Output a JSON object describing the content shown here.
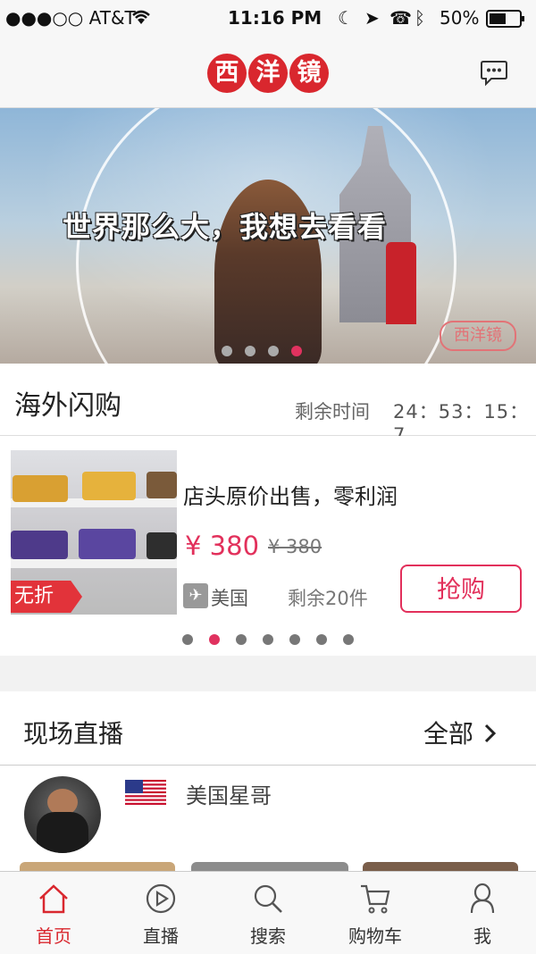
{
  "status_bar": {
    "carrier": "●●●○○ AT&T",
    "time": "11:16 PM",
    "battery": "50%"
  },
  "header": {
    "logo_chars": [
      "西",
      "洋",
      "镜"
    ],
    "message_icon": "chat-bubble-icon"
  },
  "banner": {
    "slogan": "世界那么大，我想去看看",
    "watermark": "西洋镜",
    "dots": 4,
    "active_dot": 3
  },
  "flash_sale": {
    "title": "海外闪购",
    "timer_label": "剩余时间",
    "timer": "24：53：15：7"
  },
  "product": {
    "name": "店头原价出售，零利润",
    "price": "¥ 380",
    "original_price": "¥ 380",
    "tag": "无折",
    "origin": "美国",
    "stock": "剩余20件",
    "buy_label": "抢购",
    "dots": 7,
    "active_dot": 1
  },
  "live": {
    "title": "现场直播",
    "all_label": "全部",
    "anchor_name": "美国星哥",
    "flag_icon": "us-flag-icon"
  },
  "tabbar": {
    "items": [
      {
        "label": "首页",
        "icon": "home-icon",
        "active": true
      },
      {
        "label": "直播",
        "icon": "play-icon",
        "active": false
      },
      {
        "label": "搜索",
        "icon": "search-icon",
        "active": false
      },
      {
        "label": "购物车",
        "icon": "cart-icon",
        "active": false
      },
      {
        "label": "我",
        "icon": "person-icon",
        "active": false
      }
    ]
  },
  "colors": {
    "brand_red": "#d9272e",
    "accent_pink": "#e2305b"
  }
}
